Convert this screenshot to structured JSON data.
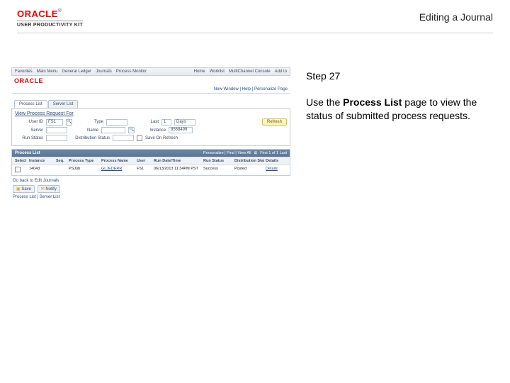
{
  "brand": {
    "name": "ORACLE",
    "tm": "®",
    "subtitle": "USER PRODUCTIVITY KIT"
  },
  "page_title": "Editing a Journal",
  "side": {
    "step": "Step 27",
    "instruction_prefix": "Use the ",
    "instruction_bold": "Process List",
    "instruction_suffix": " page to view the status of submitted process requests."
  },
  "breadcrumb": {
    "items": [
      "Favorites",
      "Main Menu",
      "General Ledger",
      "Journals",
      "Process Monitor"
    ],
    "right": [
      "Home",
      "Worklist",
      "MultiChannel Console",
      "Add to"
    ]
  },
  "inner_brand": "ORACLE",
  "top_links": [
    "New Window",
    "Help",
    "Personalize Page"
  ],
  "tabs": {
    "active": "Process List",
    "inactive": "Server List"
  },
  "form": {
    "title": "View Process Request For",
    "user_id_label": "User ID",
    "user_id_value": "FS1",
    "type_label": "Type",
    "type_value": "",
    "last_label": "Last",
    "last_value": "1",
    "last_unit": "Days",
    "refresh": "Refresh",
    "server_label": "Server",
    "server_value": "",
    "name_label": "Name",
    "name_value": "",
    "instance_label": "Instance",
    "instance_value": "8568499",
    "run_status_label": "Run Status",
    "run_status_value": "",
    "distribution_status_label": "Distribution Status",
    "distribution_status_value": "",
    "save_label": "Save On Refresh"
  },
  "grid": {
    "title": "Process List",
    "tools_left": "Personalize | Find | View All",
    "page_info": "First 1 of 1 Last",
    "headers": [
      "Select",
      "Instance",
      "Seq.",
      "Process Type",
      "Process Name",
      "User",
      "Run Date/Time",
      "Run Status",
      "Distribution Status",
      "Details"
    ],
    "row": {
      "select": "",
      "instance": "14043",
      "seq": "",
      "type": "PSJob",
      "name": "GLJEDERR",
      "user": "FS1",
      "date": "06/13/2013 11:34PM PST",
      "run_status": "Success",
      "dist_status": "Posted",
      "details": "Details"
    }
  },
  "below": {
    "back_link": "Go back to Edit Journals",
    "save": "Save",
    "notify": "Notify",
    "footer_links": "Process List | Server List"
  }
}
